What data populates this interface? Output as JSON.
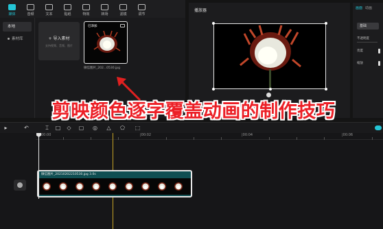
{
  "toolbar": {
    "tools": [
      {
        "label": "媒体",
        "icon": "media-icon"
      },
      {
        "label": "音频",
        "icon": "audio-icon"
      },
      {
        "label": "文本",
        "icon": "text-icon"
      },
      {
        "label": "贴纸",
        "icon": "sticker-icon"
      },
      {
        "label": "特效",
        "icon": "effects-icon"
      },
      {
        "label": "转场",
        "icon": "transition-icon"
      },
      {
        "label": "滤镜",
        "icon": "filter-icon"
      },
      {
        "label": "调节",
        "icon": "adjust-icon"
      }
    ]
  },
  "sidebar": {
    "items": [
      {
        "label": "本地"
      },
      {
        "label": "素材库"
      }
    ]
  },
  "media": {
    "import_label": "+ 导入素材",
    "import_hint": "支持视频、音频、图片",
    "thumb_badge": "已添加",
    "thumb_caption": "微信图片_202...0530.jpg"
  },
  "player": {
    "title": "播放器"
  },
  "rightpanel": {
    "tabs": [
      "画面",
      "动画"
    ],
    "button": "基础",
    "rows": [
      "不透明度",
      "亮度",
      "缩放"
    ]
  },
  "banner": {
    "text": "剪映颜色逐字覆盖动画的制作技巧"
  },
  "timeline": {
    "ruler": [
      "00:00",
      "|00:02",
      "|00:04",
      "|00:06"
    ],
    "clip_label": "微信图片_20210202210530.jpg   3.0s"
  },
  "colors": {
    "accent": "#24c5d6",
    "banner_text": "#ec1f26",
    "clip_bg": "#0f4e52",
    "marker": "#c8a526"
  }
}
